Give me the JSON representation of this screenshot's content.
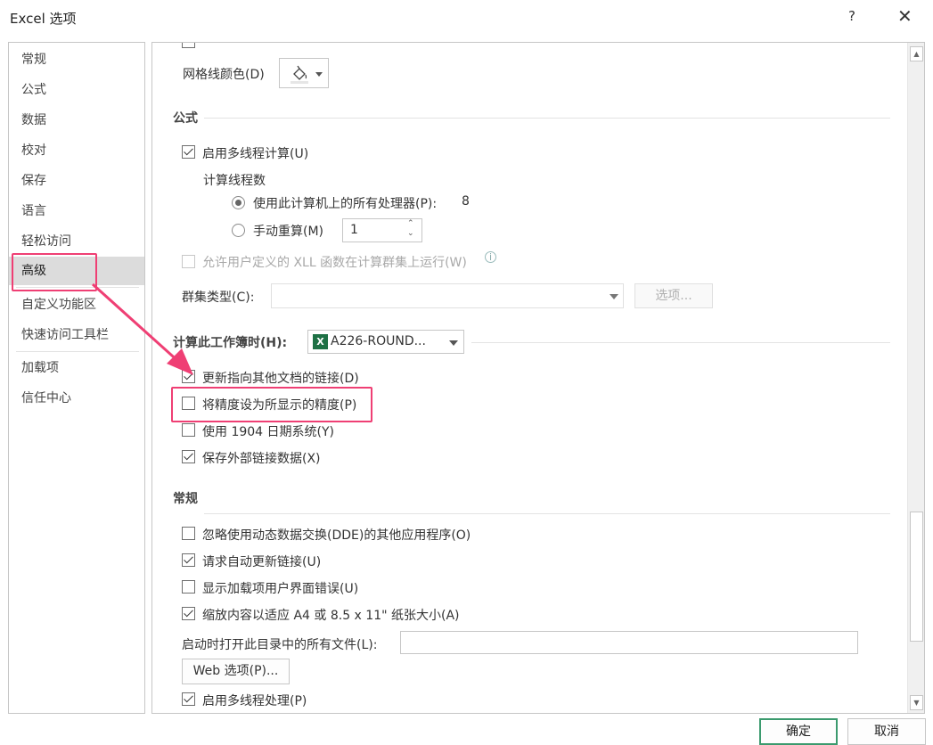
{
  "window": {
    "title": "Excel 选项",
    "help": "?",
    "close": "✕"
  },
  "sidebar": {
    "items": [
      {
        "label": "常规"
      },
      {
        "label": "公式"
      },
      {
        "label": "数据"
      },
      {
        "label": "校对"
      },
      {
        "label": "保存"
      },
      {
        "label": "语言"
      },
      {
        "label": "轻松访问"
      },
      {
        "label": "高级",
        "active": true
      },
      {
        "label": "自定义功能区"
      },
      {
        "label": "快速访问工具栏"
      },
      {
        "label": "加载项"
      },
      {
        "label": "信任中心"
      }
    ]
  },
  "content": {
    "gridline_color_label": "网格线颜色(D)",
    "gridline_color_icon": "paint-bucket-icon",
    "formulas": {
      "heading": "公式",
      "multithread_label": "启用多线程计算(U)",
      "multithread_checked": true,
      "threads_label": "计算线程数",
      "use_all_processors_label": "使用此计算机上的所有处理器(P):",
      "processor_count": "8",
      "manual_label": "手动重算(M)",
      "manual_value": "1",
      "xll_label": "允许用户定义的 XLL 函数在计算群集上运行(W)",
      "cluster_type_label": "群集类型(C):",
      "options_button": "选项..."
    },
    "workbook": {
      "heading": "计算此工作簿时(H):",
      "selected_workbook": "A226-ROUND...",
      "items": [
        {
          "label": "更新指向其他文档的链接(D)",
          "checked": true
        },
        {
          "label": "将精度设为所显示的精度(P)",
          "checked": false
        },
        {
          "label": "使用 1904 日期系统(Y)",
          "checked": false
        },
        {
          "label": "保存外部链接数据(X)",
          "checked": true
        }
      ]
    },
    "general": {
      "heading": "常规",
      "items": [
        {
          "label": "忽略使用动态数据交换(DDE)的其他应用程序(O)",
          "checked": false
        },
        {
          "label": "请求自动更新链接(U)",
          "checked": true
        },
        {
          "label": "显示加载项用户界面错误(U)",
          "checked": false
        },
        {
          "label": "缩放内容以适应 A4 或 8.5 x 11\" 纸张大小(A)",
          "checked": true
        }
      ],
      "startup_label": "启动时打开此目录中的所有文件(L):",
      "web_options_button": "Web 选项(P)...",
      "multiprocess_label": "启用多线程处理(P)"
    }
  },
  "footer": {
    "ok": "确定",
    "cancel": "取消"
  },
  "colors": {
    "highlight": "#ef3f74",
    "primary_border": "#3b9a6e",
    "excel_green": "#1e7145"
  }
}
